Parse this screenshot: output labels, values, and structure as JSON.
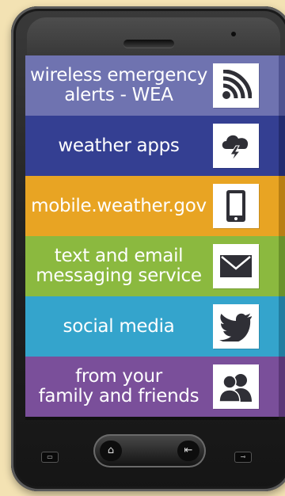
{
  "bands": [
    {
      "label": "wireless emergency alerts - WEA",
      "line1": "wireless emergency",
      "line2": "alerts - WEA",
      "color": "#6f73b0",
      "edge": "#4f5390",
      "icon": "signal-waves-icon"
    },
    {
      "label": "weather apps",
      "line1": "weather apps",
      "line2": "",
      "color": "#343f92",
      "edge": "#232c6f",
      "icon": "storm-cloud-icon"
    },
    {
      "label": "mobile.weather.gov",
      "line1": "mobile.weather.gov",
      "line2": "",
      "color": "#e8a423",
      "edge": "#b87f14",
      "icon": "smartphone-icon"
    },
    {
      "label": "text and email messaging service",
      "line1": "text and email",
      "line2": "messaging service",
      "color": "#8bb93f",
      "edge": "#6a922b",
      "icon": "envelope-icon"
    },
    {
      "label": "social media",
      "line1": "social media",
      "line2": "",
      "color": "#34a4cc",
      "edge": "#227da0",
      "icon": "bird-icon"
    },
    {
      "label": "from your family and friends",
      "line1": "from your",
      "line2": "family and friends",
      "color": "#7a4f9a",
      "edge": "#5b3777",
      "icon": "people-icon"
    }
  ],
  "phone": {
    "home_glyph": "⌂",
    "back_glyph": "⇤"
  }
}
